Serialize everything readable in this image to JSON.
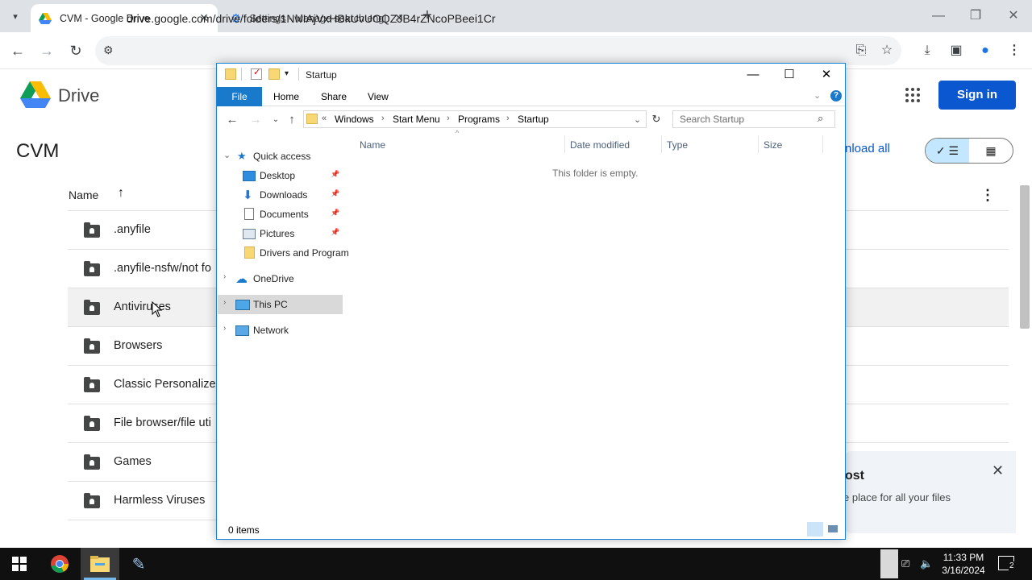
{
  "browser": {
    "tabs": [
      {
        "title": "CVM - Google Drive",
        "active": true
      },
      {
        "title": "Settings - Manage search engi",
        "active": false
      }
    ],
    "url": "drive.google.com/drive/folders/1NwIAjVxHBkUvUOQZJB4rZNcoPBeei1Cr"
  },
  "drive": {
    "logo_text": "Drive",
    "sign_in_label": "Sign in",
    "folder_title": "CVM",
    "download_all_partial": "nload all",
    "name_header": "Name",
    "rows": [
      ".anyfile",
      ".anyfile-nsfw/not fo",
      "Antiviruses",
      "Browsers",
      "Classic Personalize",
      "File browser/file uti",
      "Games",
      "Harmless Viruses"
    ],
    "promo_title_partial": "ost",
    "promo_text_partial": "e place for all your files"
  },
  "explorer": {
    "title": "Startup",
    "ribbon_tabs": [
      "File",
      "Home",
      "Share",
      "View"
    ],
    "breadcrumb_overflow": "«",
    "breadcrumbs": [
      "Windows",
      "Start Menu",
      "Programs",
      "Startup"
    ],
    "search_placeholder": "Search Startup",
    "nav": {
      "quick_access": "Quick access",
      "pinned": [
        "Desktop",
        "Downloads",
        "Documents",
        "Pictures"
      ],
      "extra": "Drivers and Program",
      "onedrive": "OneDrive",
      "this_pc": "This PC",
      "network": "Network"
    },
    "columns": [
      "Name",
      "Date modified",
      "Type",
      "Size"
    ],
    "empty_message": "This folder is empty.",
    "status": "0 items"
  },
  "taskbar": {
    "time": "11:33 PM",
    "date": "3/16/2024",
    "notification_count": "2"
  },
  "colors": {
    "accent_blue": "#0b57d0",
    "explorer_blue": "#1979ca",
    "taskbar": "#101010"
  }
}
